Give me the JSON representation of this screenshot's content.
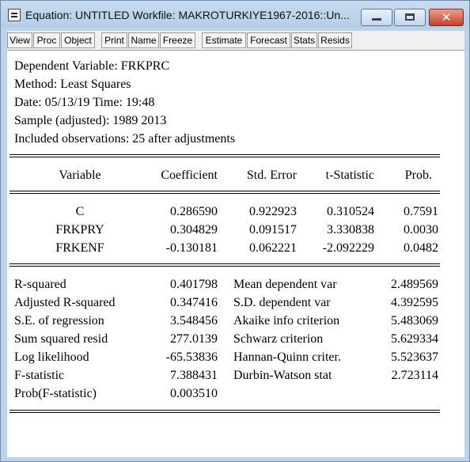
{
  "window": {
    "title": "Equation: UNTITLED   Workfile: MAKROTURKIYE1967-2016::Un...",
    "close_glyph": "✕"
  },
  "toolbar": [
    "View",
    "Proc",
    "Object",
    "Print",
    "Name",
    "Freeze",
    "Estimate",
    "Forecast",
    "Stats",
    "Resids"
  ],
  "header": {
    "dependent": "Dependent Variable: FRKPRC",
    "method": "Method: Least Squares",
    "date": "Date: 05/13/19   Time: 19:48",
    "sample": "Sample (adjusted): 1989 2013",
    "obs": "Included observations: 25 after adjustments"
  },
  "coef_table": {
    "headers": [
      "Variable",
      "Coefficient",
      "Std. Error",
      "t-Statistic",
      "Prob."
    ],
    "rows": [
      [
        "C",
        "0.286590",
        "0.922923",
        "0.310524",
        "0.7591"
      ],
      [
        "FRKPRY",
        "0.304829",
        "0.091517",
        "3.330838",
        "0.0030"
      ],
      [
        "FRKENF",
        "-0.130181",
        "0.062221",
        "-2.092229",
        "0.0482"
      ]
    ]
  },
  "stats": {
    "left": [
      [
        "R-squared",
        "0.401798"
      ],
      [
        "Adjusted R-squared",
        "0.347416"
      ],
      [
        "S.E. of regression",
        "3.548456"
      ],
      [
        "Sum squared resid",
        "277.0139"
      ],
      [
        "Log likelihood",
        "-65.53836"
      ],
      [
        "F-statistic",
        "7.388431"
      ],
      [
        "Prob(F-statistic)",
        "0.003510"
      ]
    ],
    "right": [
      [
        "Mean dependent var",
        "2.489569"
      ],
      [
        "S.D. dependent var",
        "4.392595"
      ],
      [
        "Akaike info criterion",
        "5.483069"
      ],
      [
        "Schwarz criterion",
        "5.629334"
      ],
      [
        "Hannan-Quinn criter.",
        "5.523637"
      ],
      [
        "Durbin-Watson stat",
        "2.723114"
      ]
    ]
  }
}
